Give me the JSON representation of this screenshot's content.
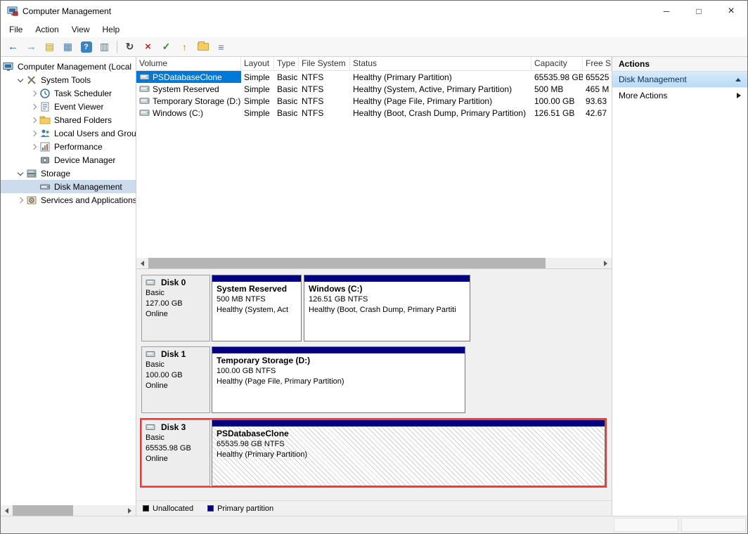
{
  "window": {
    "title": "Computer Management",
    "controls": {
      "minimize": "─",
      "maximize": "□",
      "close": "×"
    }
  },
  "menubar": {
    "items": [
      "File",
      "Action",
      "View",
      "Help"
    ]
  },
  "toolbar": {
    "icons": [
      {
        "name": "back-icon",
        "glyph": "←"
      },
      {
        "name": "forward-icon",
        "glyph": "→"
      },
      {
        "name": "console-tree-icon",
        "glyph": "▤"
      },
      {
        "name": "export-list-icon",
        "glyph": "▦"
      },
      {
        "name": "help-icon",
        "glyph": "?"
      },
      {
        "name": "properties-icon",
        "glyph": "▥"
      },
      {
        "name": "refresh-icon",
        "glyph": "↻"
      },
      {
        "name": "delete-volume-icon",
        "glyph": "×"
      },
      {
        "name": "check-disk-icon",
        "glyph": "✓"
      },
      {
        "name": "up-level-icon",
        "glyph": "↑"
      },
      {
        "name": "open-folder-icon",
        "glyph": ""
      },
      {
        "name": "list-view-icon",
        "glyph": "≡"
      }
    ]
  },
  "tree": {
    "items": [
      {
        "label": "Computer Management (Local",
        "icon": "computer-icon"
      },
      {
        "label": "System Tools",
        "icon": "system-tools-icon"
      },
      {
        "label": "Task Scheduler",
        "icon": "task-scheduler-icon"
      },
      {
        "label": "Event Viewer",
        "icon": "event-viewer-icon"
      },
      {
        "label": "Shared Folders",
        "icon": "shared-folders-icon"
      },
      {
        "label": "Local Users and Groups",
        "icon": "users-icon"
      },
      {
        "label": "Performance",
        "icon": "performance-icon"
      },
      {
        "label": "Device Manager",
        "icon": "device-manager-icon"
      },
      {
        "label": "Storage",
        "icon": "storage-icon"
      },
      {
        "label": "Disk Management",
        "icon": "disk-management-icon"
      },
      {
        "label": "Services and Applications",
        "icon": "services-icon"
      }
    ]
  },
  "volume_list": {
    "columns": [
      "Volume",
      "Layout",
      "Type",
      "File System",
      "Status",
      "Capacity",
      "Free S"
    ],
    "rows": [
      {
        "volume": "PSDatabaseClone",
        "layout": "Simple",
        "type": "Basic",
        "fs": "NTFS",
        "status": "Healthy (Primary Partition)",
        "capacity": "65535.98 GB",
        "free": "65525"
      },
      {
        "volume": "System Reserved",
        "layout": "Simple",
        "type": "Basic",
        "fs": "NTFS",
        "status": "Healthy (System, Active, Primary Partition)",
        "capacity": "500 MB",
        "free": "465 M"
      },
      {
        "volume": "Temporary Storage (D:)",
        "layout": "Simple",
        "type": "Basic",
        "fs": "NTFS",
        "status": "Healthy (Page File, Primary Partition)",
        "capacity": "100.00 GB",
        "free": "93.63"
      },
      {
        "volume": "Windows (C:)",
        "layout": "Simple",
        "type": "Basic",
        "fs": "NTFS",
        "status": "Healthy (Boot, Crash Dump, Primary Partition)",
        "capacity": "126.51 GB",
        "free": "42.67"
      }
    ]
  },
  "disks": [
    {
      "name": "Disk 0",
      "kind": "Basic",
      "size": "127.00 GB",
      "status": "Online",
      "partitions": [
        {
          "title": "System Reserved",
          "size": "500 MB NTFS",
          "status": "Healthy (System, Act"
        },
        {
          "title": "Windows  (C:)",
          "size": "126.51 GB NTFS",
          "status": "Healthy (Boot, Crash Dump, Primary Partiti"
        }
      ]
    },
    {
      "name": "Disk 1",
      "kind": "Basic",
      "size": "100.00 GB",
      "status": "Online",
      "partitions": [
        {
          "title": "Temporary Storage  (D:)",
          "size": "100.00 GB NTFS",
          "status": "Healthy (Page File, Primary Partition)"
        }
      ]
    },
    {
      "name": "Disk 3",
      "kind": "Basic",
      "size": "65535.98 GB",
      "status": "Online",
      "partitions": [
        {
          "title": "PSDatabaseClone",
          "size": "65535.98 GB NTFS",
          "status": "Healthy (Primary Partition)"
        }
      ]
    }
  ],
  "legend": {
    "items": [
      {
        "label": "Unallocated",
        "color": "#000000"
      },
      {
        "label": "Primary partition",
        "color": "#000080"
      }
    ]
  },
  "actions": {
    "title": "Actions",
    "group_label": "Disk Management",
    "more_label": "More Actions"
  },
  "colors": {
    "accent": "#0078d7",
    "primary_partition": "#000080",
    "unallocated": "#000000",
    "selected_disk_border": "#ff0000"
  }
}
